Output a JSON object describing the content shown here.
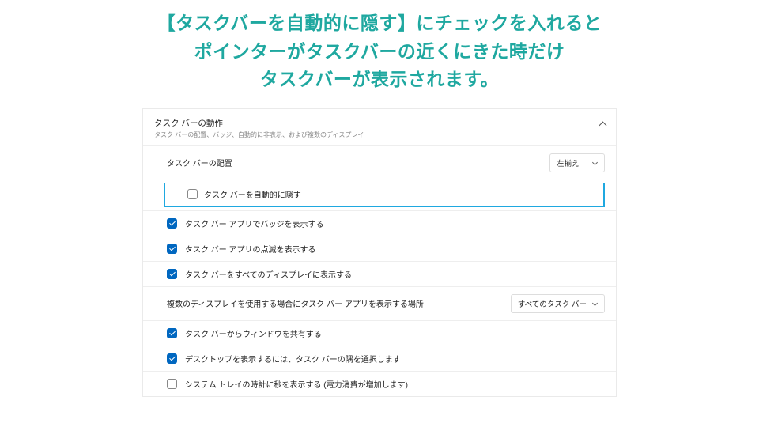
{
  "instruction": {
    "line1": "【タスクバーを自動的に隠す】にチェックを入れると",
    "line2": "ポインターがタスクバーの近くにきた時だけ",
    "line3": "タスクバーが表示されます。"
  },
  "section": {
    "title": "タスク バーの動作",
    "subtitle": "タスク バーの配置、バッジ、自動的に非表示、および複数のディスプレイ"
  },
  "alignment_row": {
    "label": "タスク バーの配置",
    "value": "左揃え"
  },
  "options": {
    "auto_hide": "タスク バーを自動的に隠す",
    "show_badges": "タスク バー アプリでバッジを表示する",
    "show_flashing": "タスク バー アプリの点滅を表示する",
    "show_all_displays": "タスク バーをすべてのディスプレイに表示する",
    "share_window": "タスク バーからウィンドウを共有する",
    "select_corner": "デスクトップを表示するには、タスク バーの隅を選択します",
    "show_seconds": "システム トレイの時計に秒を表示する (電力消費が増加します)"
  },
  "multi_display_row": {
    "label": "複数のディスプレイを使用する場合にタスク バー アプリを表示する場所",
    "value": "すべてのタスク バー"
  }
}
